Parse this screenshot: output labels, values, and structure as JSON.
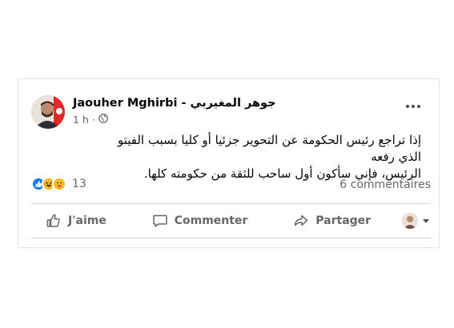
{
  "post": {
    "author": "Jaouher Mghirbi - جوهر المغيربي",
    "time": "1 h ·",
    "audience_icon": "globe-icon",
    "text_line1": "إذا تراجع رئيس الحكومة عن التحوير جزئيا أو كليا بسبب الفيتو الذي رفعه",
    "text_line2": "الرئيس، فإني سأكون أول ساحب للثقة من حكومته كلها.",
    "reaction_count": "13",
    "reactions": [
      "like-icon",
      "haha-icon",
      "care-icon"
    ],
    "comments": "6 commentaires"
  },
  "actions": {
    "like": "J'aime",
    "comment": "Commenter",
    "share": "Partager"
  },
  "colors": {
    "like_blue": "#1877f2",
    "reaction_yellow": "#f7b928",
    "secondary_text": "#65676b",
    "divider": "#ced0d4"
  }
}
